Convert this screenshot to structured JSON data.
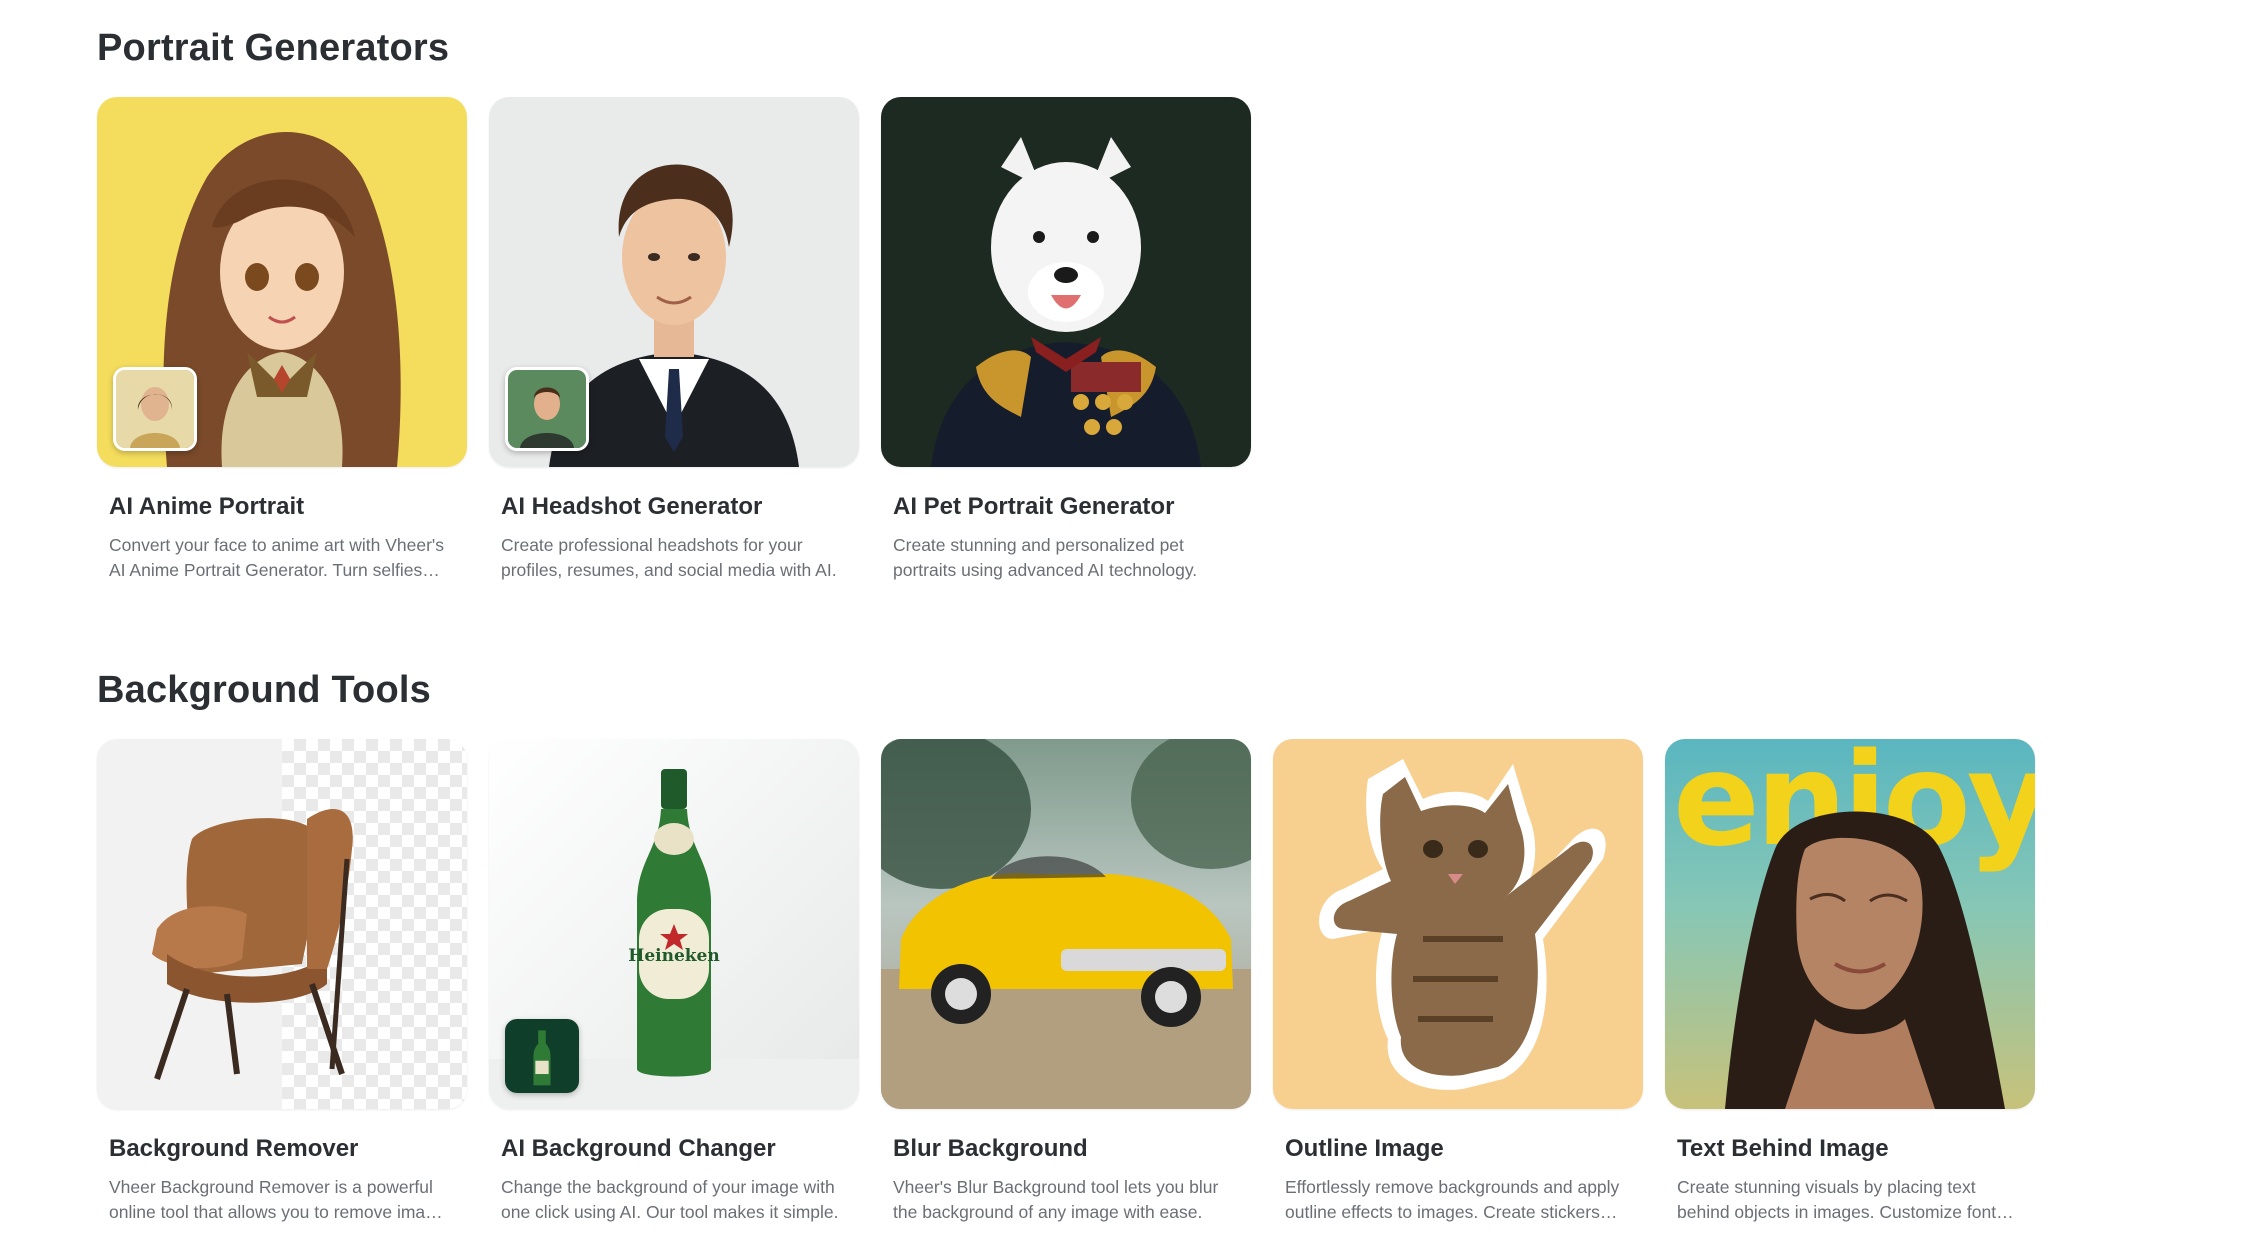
{
  "sections": [
    {
      "title": "Portrait Generators",
      "cards": [
        {
          "title": "AI Anime Portrait",
          "desc": "Convert your face to anime art with Vheer's AI Anime Portrait Generator. Turn selfies into stunning anime-style portraits."
        },
        {
          "title": "AI Headshot Generator",
          "desc": "Create professional headshots for your profiles, resumes, and social media with AI."
        },
        {
          "title": "AI Pet Portrait Generator",
          "desc": "Create stunning and personalized pet portraits using advanced AI technology."
        }
      ]
    },
    {
      "title": "Background Tools",
      "cards": [
        {
          "title": "Background Remover",
          "desc": "Vheer Background Remover is a powerful online tool that allows you to remove image backgrounds."
        },
        {
          "title": "AI Background Changer",
          "desc": "Change the background of your image with one click using AI. Our tool makes it simple."
        },
        {
          "title": "Blur Background",
          "desc": "Vheer's Blur Background tool lets you blur the background of any image with ease."
        },
        {
          "title": "Outline Image",
          "desc": "Effortlessly remove backgrounds and apply outline effects to images. Create stickers fast."
        },
        {
          "title": "Text Behind Image",
          "desc": "Create stunning visuals by placing text behind objects in images. Customize fonts and colors."
        }
      ]
    }
  ],
  "images": {
    "bottle_label": "Heineken",
    "text_behind_word": "enjoy"
  },
  "colors": {
    "anime_bg": "#f4dc5c",
    "outline_bg": "#f7cf8f",
    "enjoy_text": "#f2d21a"
  }
}
